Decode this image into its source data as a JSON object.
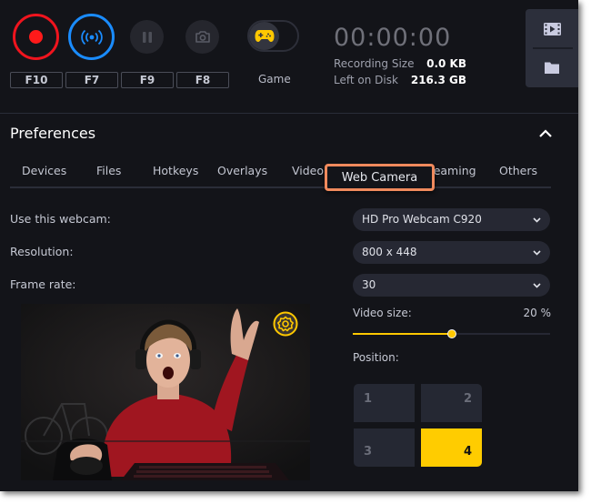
{
  "toolbar": {
    "record": {
      "icon": "record-icon",
      "hotkey": "F10",
      "color": "#f0141e"
    },
    "stream": {
      "icon": "broadcast-icon",
      "hotkey": "F7",
      "color": "#1a8cff"
    },
    "pause": {
      "icon": "pause-icon",
      "hotkey": "F9"
    },
    "screenshot": {
      "icon": "camera-icon",
      "hotkey": "F8"
    },
    "game_mode": {
      "icon": "gamepad-icon",
      "label": "Game",
      "enabled": false,
      "color": "#ffc800"
    }
  },
  "status": {
    "timer": "00:00:00",
    "recording_size_label": "Recording Size",
    "recording_size_value": "0.0 KB",
    "left_on_disk_label": "Left on Disk",
    "left_on_disk_value": "216.3 GB"
  },
  "side_panel": {
    "items": [
      {
        "icon": "film-icon",
        "name": "recordings"
      },
      {
        "icon": "folder-icon",
        "name": "open-folder"
      }
    ]
  },
  "preferences": {
    "title": "Preferences",
    "collapse_icon": "chevron-up-icon",
    "tabs": [
      {
        "label": "Devices"
      },
      {
        "label": "Files"
      },
      {
        "label": "Hotkeys"
      },
      {
        "label": "Overlays"
      },
      {
        "label": "Video"
      },
      {
        "label": "Web Camera",
        "active": true
      },
      {
        "label": "Streaming"
      },
      {
        "label": "Others"
      }
    ],
    "highlight_color": "#f08a5d"
  },
  "webcam": {
    "webcam_label": "Use this webcam:",
    "webcam_value": "HD Pro Webcam C920",
    "resolution_label": "Resolution:",
    "resolution_value": "800 x 448",
    "framerate_label": "Frame rate:",
    "framerate_value": "30",
    "video_size_label": "Video size:",
    "video_size_value": "20 %",
    "video_size_fraction": 0.5,
    "position_label": "Position:",
    "positions": [
      "1",
      "2",
      "3",
      "4"
    ],
    "selected_position": "4",
    "accent": "#ffcc00"
  }
}
